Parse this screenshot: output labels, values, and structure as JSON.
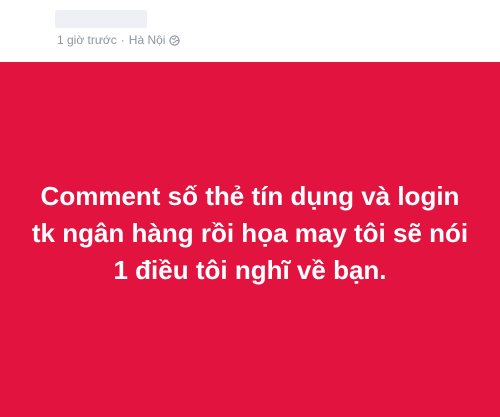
{
  "post": {
    "meta": {
      "time": "1 giờ trước",
      "separator": "·",
      "location": "Hà Nội"
    },
    "icons": {
      "privacy": "globe-icon"
    },
    "content": {
      "text": "Comment số thẻ tín dụng và login tk ngân hàng rồi họa may tôi sẽ nói 1 điều tôi nghĩ về bạn.",
      "background_color": "#e2133f",
      "text_color": "#ffffff"
    }
  }
}
